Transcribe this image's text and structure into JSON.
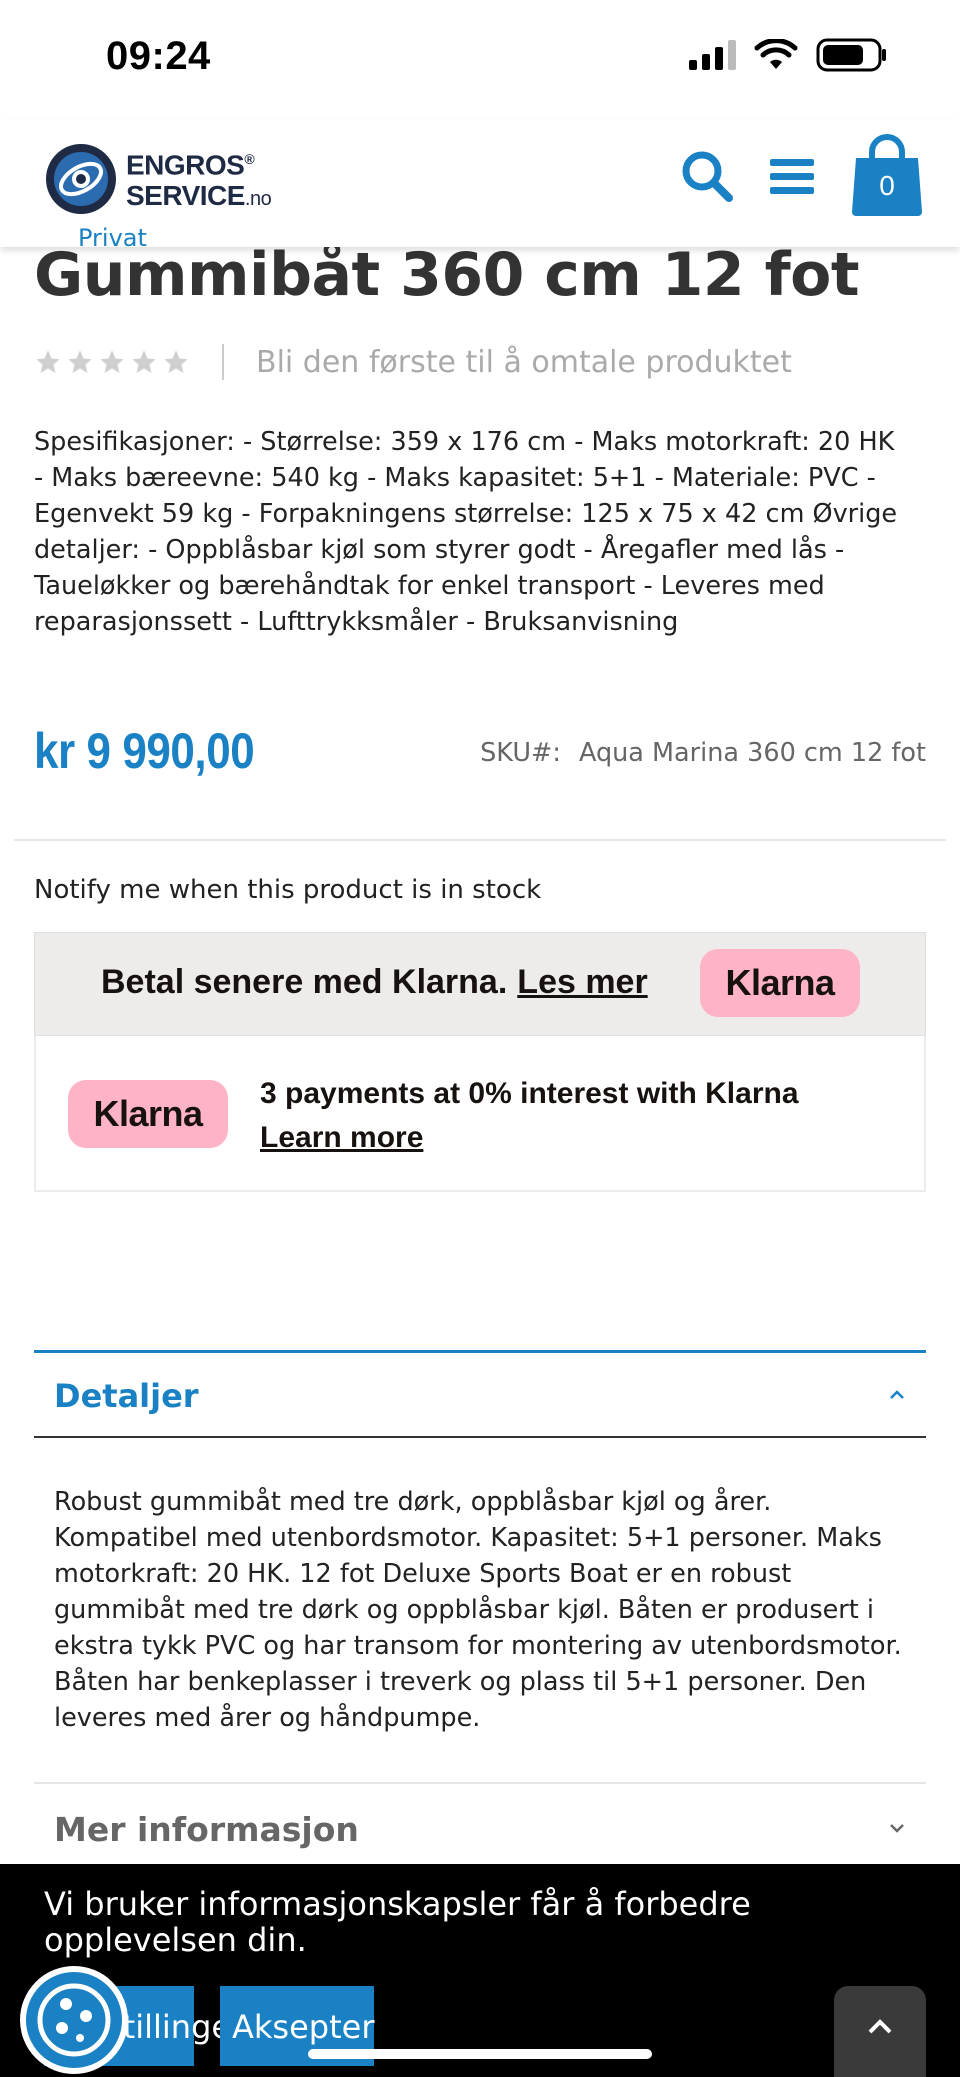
{
  "status_bar": {
    "time": "09:24",
    "icons": [
      "signal-icon",
      "wifi-icon",
      "battery-icon"
    ]
  },
  "header": {
    "logo_line1": "ENGROS",
    "logo_line2": "SERVICE",
    "logo_domain": ".no",
    "logo_registered": "®",
    "sub_label": "Privat",
    "cart_count": "0",
    "accent_color": "#1a82c4"
  },
  "product": {
    "title": "Gummibåt 360 cm 12 fot",
    "rating_stars": 0,
    "rating_max": 5,
    "review_link": "Bli den første til å omtale produktet",
    "description": "Spesifikasjoner: - Størrelse: 359 x 176 cm - Maks motorkraft: 20 HK - Maks bæreevne: 540 kg - Maks kapasitet: 5+1 - Materiale: PVC - Egenvekt 59 kg - Forpakningens størrelse: 125 x 75 x 42 cm Øvrige detaljer: - Oppblåsbar kjøl som styrer godt - Åregafler med lås - Taueløkker og bærehåndtak for enkel transport - Leveres med reparasjonssett - Lufttrykksmåler - Bruksanvisning",
    "price": "kr 9 990,00",
    "sku_label": "SKU#:",
    "sku_value": "Aqua Marina 360 cm 12 fot",
    "notify": "Notify me when this product is in stock"
  },
  "klarna": {
    "banner_text": "Betal senere med Klarna.",
    "banner_link": "Les mer",
    "badge": "Klarna",
    "box_text": "3 payments at 0% interest with Klarna",
    "box_link": "Learn more"
  },
  "details": {
    "title": "Detaljer",
    "body": "Robust gummibåt med tre dørk, oppblåsbar kjøl og årer. Kompatibel med utenbordsmotor. Kapasitet: 5+1 personer. Maks motorkraft: 20 HK. 12 fot Deluxe Sports Boat er en robust gummibåt med tre dørk og oppblåsbar kjøl. Båten er produsert i ekstra tykk PVC og har transom for montering av utenbordsmotor. Båten har benkeplasser i treverk og plass til 5+1 personer. Den leveres med årer og håndpumpe.",
    "more_title": "Mer informasjon"
  },
  "cookie": {
    "text": "Vi bruker informasjonskapsler får å forbedre opplevelsen din.",
    "settings_button": "Innstillinger!",
    "accept_button": "Aksepter"
  }
}
